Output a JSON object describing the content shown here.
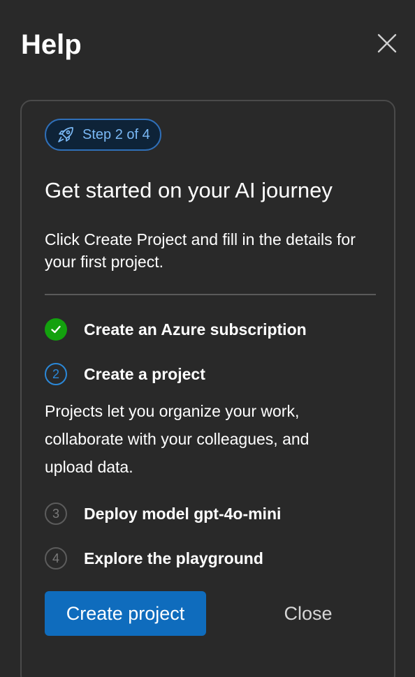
{
  "panel": {
    "title": "Help",
    "close_icon": "close-icon"
  },
  "card": {
    "badge": {
      "icon": "rocket-icon",
      "label": "Step 2 of 4"
    },
    "heading": "Get started on your AI journey",
    "description": "Click Create Project and fill in the details for your first project.",
    "steps": [
      {
        "number": "1",
        "label": "Create an Azure subscription",
        "status": "completed",
        "icon": "checkmark-icon"
      },
      {
        "number": "2",
        "label": "Create a project",
        "status": "current",
        "detail": "Projects let you organize your work, collaborate with your colleagues, and upload data."
      },
      {
        "number": "3",
        "label": "Deploy model gpt-4o-mini",
        "status": "pending"
      },
      {
        "number": "4",
        "label": "Explore the playground",
        "status": "pending"
      }
    ],
    "actions": {
      "primary_label": "Create project",
      "secondary_label": "Close"
    }
  },
  "colors": {
    "background": "#292929",
    "accent": "#0f6cbd",
    "success": "#13a10e",
    "current_step": "#2b88d8",
    "badge_text": "#7ab8f5"
  }
}
